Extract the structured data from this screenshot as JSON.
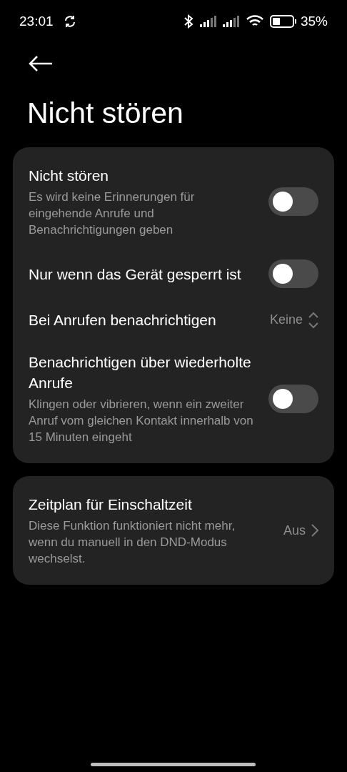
{
  "status_bar": {
    "time": "23:01",
    "battery_percent": "35%"
  },
  "title": "Nicht stören",
  "cards": [
    {
      "rows": [
        {
          "kind": "toggle",
          "title": "Nicht stören",
          "subtitle": "Es wird keine Erinnerungen für eingehende Anrufe und Benachrichtigungen geben",
          "on": false
        },
        {
          "kind": "toggle",
          "title": "Nur wenn das Gerät gesperrt ist",
          "on": false
        },
        {
          "kind": "select",
          "title": "Bei Anrufen benachrichtigen",
          "value": "Keine"
        },
        {
          "kind": "toggle",
          "title": "Benachrichtigen über wiederholte Anrufe",
          "subtitle": "Klingen oder vibrieren, wenn ein zweiter Anruf vom gleichen Kontakt innerhalb von 15 Minuten eingeht",
          "on": false
        }
      ]
    },
    {
      "rows": [
        {
          "kind": "link",
          "title": "Zeitplan für Einschaltzeit",
          "subtitle": "Diese Funktion funktioniert nicht mehr, wenn du manuell in den DND-Modus wechselst.",
          "value": "Aus"
        }
      ]
    }
  ]
}
